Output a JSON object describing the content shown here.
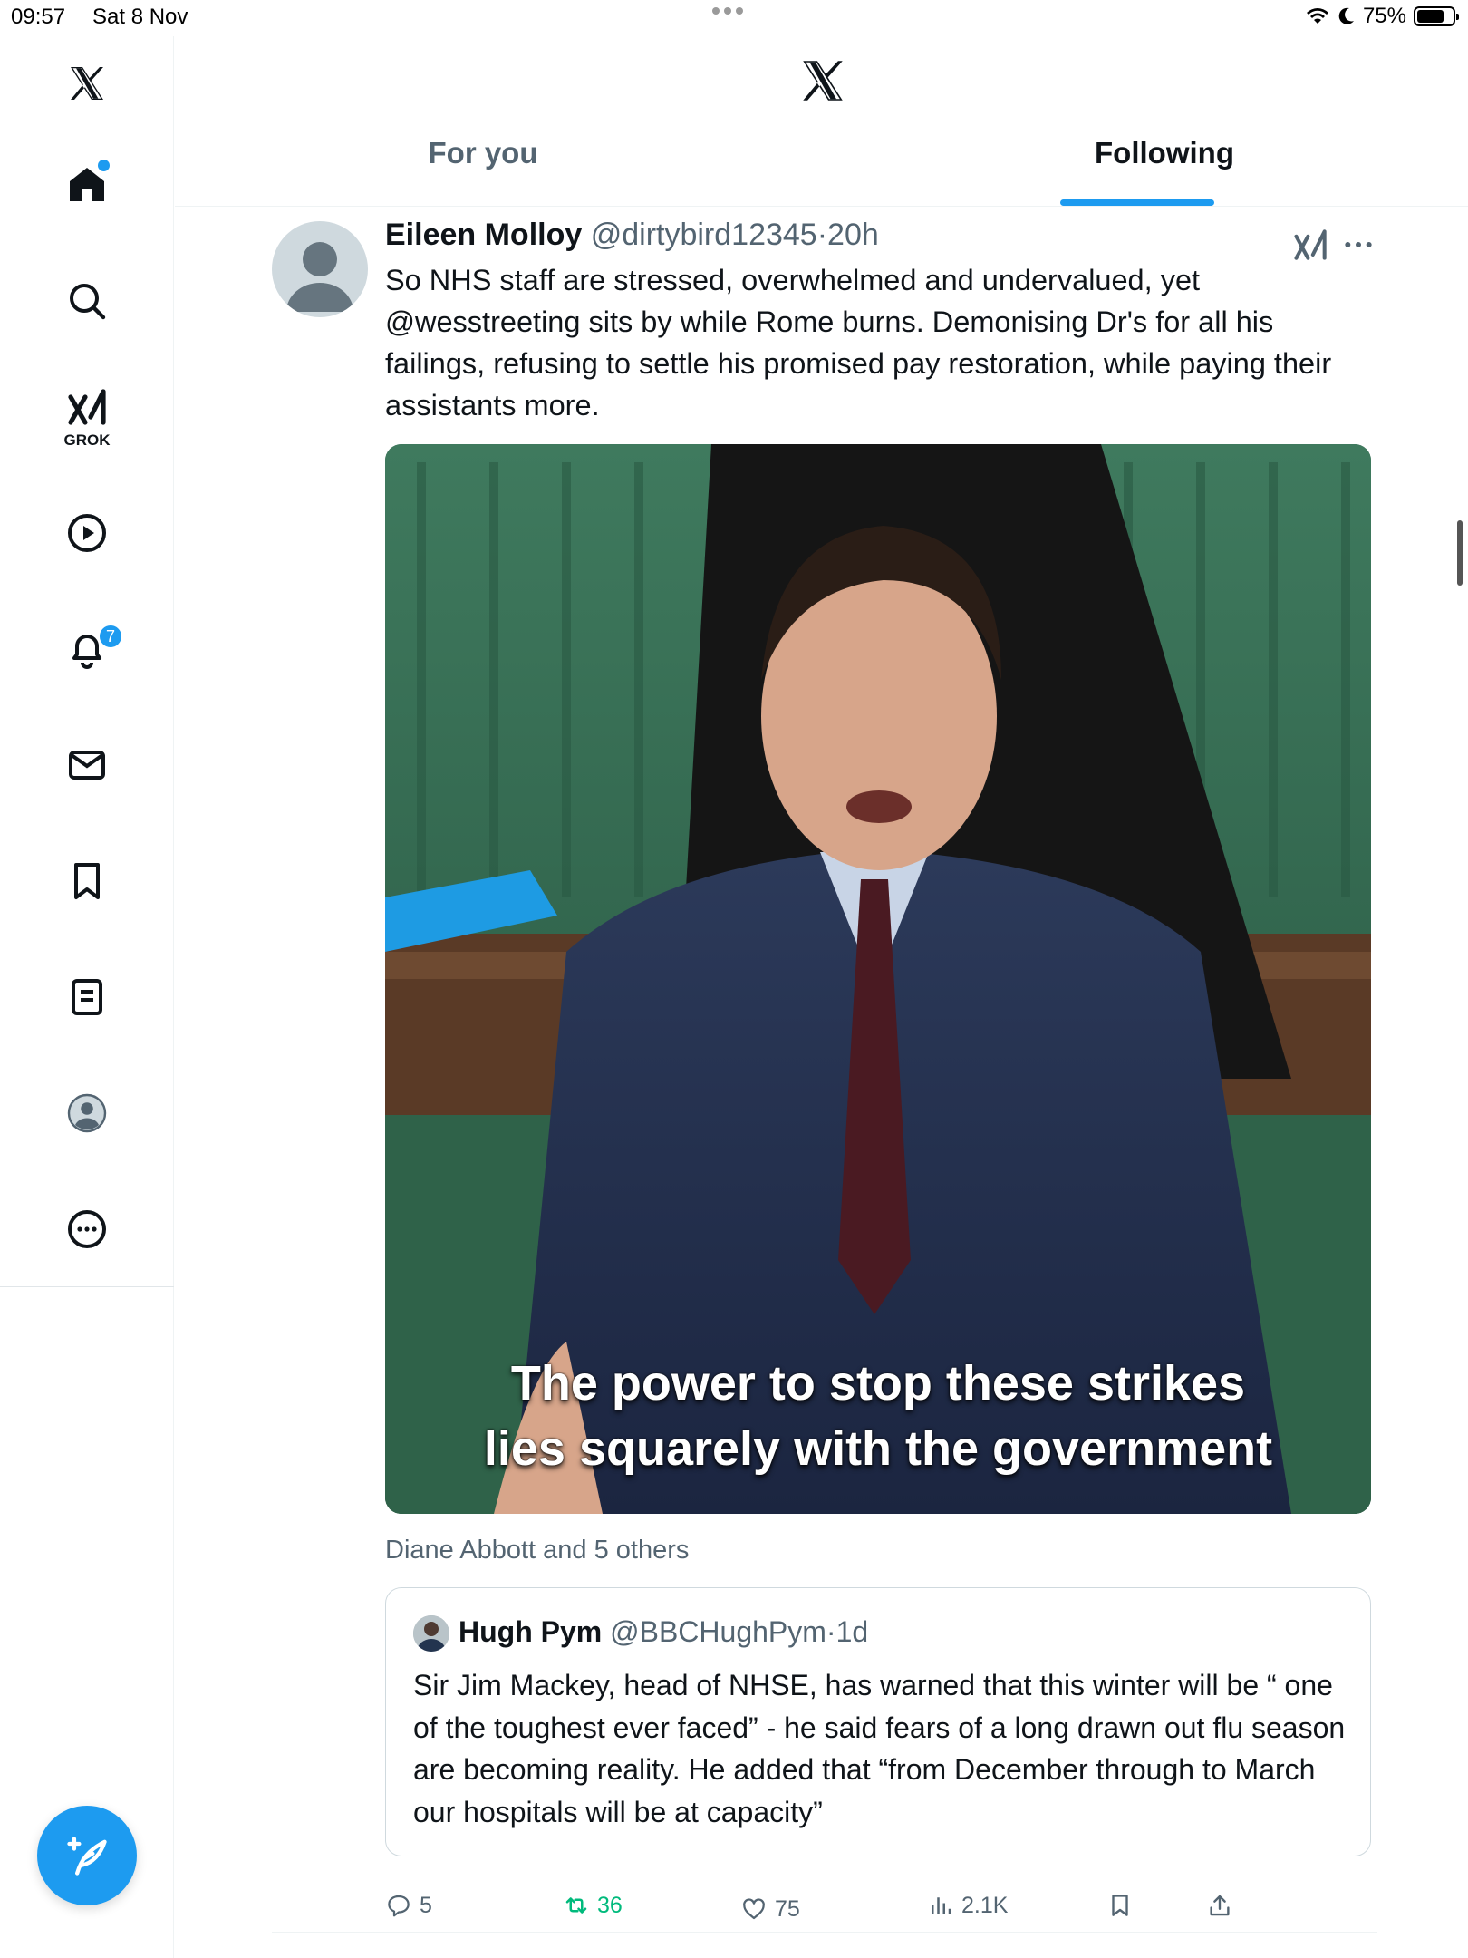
{
  "status_bar": {
    "time": "09:57",
    "date": "Sat 8 Nov",
    "battery": "75%",
    "battery_level": 0.75
  },
  "sidebar": {
    "items": [
      {
        "name": "home",
        "icon": "home-icon",
        "active": true
      },
      {
        "name": "explore",
        "icon": "search-icon"
      },
      {
        "name": "grok",
        "icon": "grok-icon",
        "label": "GROK"
      },
      {
        "name": "video",
        "icon": "play-icon"
      },
      {
        "name": "notifications",
        "icon": "bell-icon",
        "badge": "7"
      },
      {
        "name": "messages",
        "icon": "mail-icon"
      },
      {
        "name": "bookmarks",
        "icon": "bookmark-icon"
      },
      {
        "name": "lists",
        "icon": "list-icon"
      },
      {
        "name": "profile",
        "icon": "profile-icon"
      },
      {
        "name": "more",
        "icon": "more-icon"
      }
    ],
    "compose_icon": "compose-feather-icon"
  },
  "header": {
    "logo": "x-logo-icon",
    "tabs": [
      {
        "label": "For you",
        "active": false
      },
      {
        "label": "Following",
        "active": true
      }
    ]
  },
  "tweet": {
    "author_name": "Eileen Molloy",
    "handle": "@dirtybird12345",
    "separator": "·",
    "time": "20h",
    "text": "So NHS staff are stressed, overwhelmed and undervalued, yet @wesstreeting sits by while Rome burns. Demonising Dr's for all his failings, refusing to settle his promised pay restoration, while paying their assistants more.",
    "media": {
      "caption_line1": "The power to stop these strikes",
      "caption_line2": "lies squarely with the government"
    },
    "social_context": "Diane Abbott and 5 others",
    "quote": {
      "author_name": "Hugh Pym",
      "handle": "@BBCHughPym",
      "separator": "·",
      "time": "1d",
      "text": "Sir Jim Mackey, head of NHSE, has warned that this winter will be “ one of the toughest ever faced” - he said fears of a long drawn out flu season are becoming reality. He added that “from December through to March our hospitals will be at capacity”"
    },
    "actions": {
      "replies": "5",
      "reposts": "36",
      "likes": "75",
      "views": "2.1K"
    }
  },
  "colors": {
    "accent": "#1d9bf0",
    "repost_green": "#00ba7c",
    "secondary_text": "#536471"
  }
}
